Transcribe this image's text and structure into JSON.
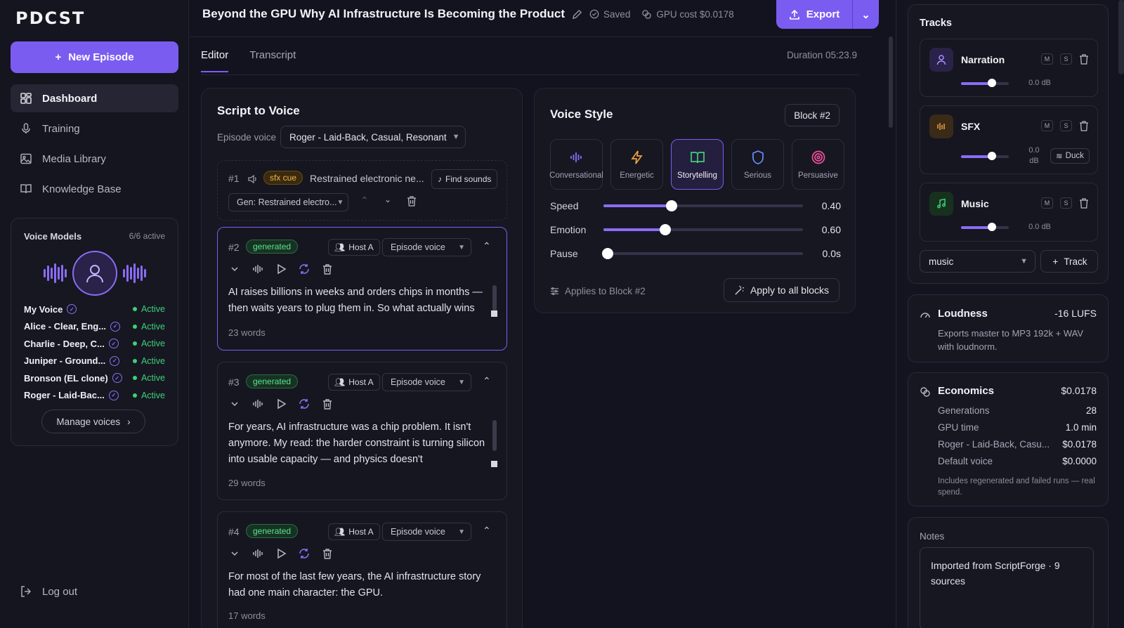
{
  "app": {
    "logo": "PDCST",
    "new_episode": "New Episode",
    "logout": "Log out"
  },
  "nav": [
    {
      "label": "Dashboard",
      "icon": "dashboard-icon",
      "active": true
    },
    {
      "label": "Training",
      "icon": "microphone-icon",
      "active": false
    },
    {
      "label": "Media Library",
      "icon": "image-icon",
      "active": false
    },
    {
      "label": "Knowledge Base",
      "icon": "book-icon",
      "active": false
    }
  ],
  "voice_models": {
    "title": "Voice Models",
    "count": "6/6 active",
    "items": [
      {
        "name": "My Voice",
        "status": "Active"
      },
      {
        "name": "Alice - Clear, Eng...",
        "status": "Active"
      },
      {
        "name": "Charlie - Deep, C...",
        "status": "Active"
      },
      {
        "name": "Juniper - Ground...",
        "status": "Active"
      },
      {
        "name": "Bronson (EL clone)",
        "status": "Active"
      },
      {
        "name": "Roger - Laid-Bac...",
        "status": "Active"
      }
    ],
    "manage": "Manage voices"
  },
  "header": {
    "title": "Beyond the GPU Why AI Infrastructure Is Becoming the Product",
    "saved": "Saved",
    "gpu_cost": "GPU cost $0.0178",
    "export": "Export"
  },
  "tabs": [
    {
      "label": "Editor",
      "active": true
    },
    {
      "label": "Transcript",
      "active": false
    }
  ],
  "duration": "Duration 05:23.9",
  "script": {
    "title": "Script to Voice",
    "episode_voice_label": "Episode voice",
    "episode_voice": "Roger - Laid-Back, Casual, Resonant",
    "sfx_block": {
      "num": "#1",
      "badge": "sfx cue",
      "text": "Restrained electronic ne...",
      "find": "Find sounds",
      "gen_select": "Gen: Restrained electro..."
    },
    "blocks": [
      {
        "num": "#2",
        "badge": "generated",
        "host": "Host A",
        "voice": "Episode voice",
        "text": "AI raises billions in weeks and orders chips in months — then waits years to plug them in. So what actually wins",
        "words": "23 words"
      },
      {
        "num": "#3",
        "badge": "generated",
        "host": "Host A",
        "voice": "Episode voice",
        "text": "For years, AI infrastructure was a chip problem. It isn't anymore. My read: the harder constraint is turning silicon into usable capacity — and physics doesn't",
        "words": "29 words"
      },
      {
        "num": "#4",
        "badge": "generated",
        "host": "Host A",
        "voice": "Episode voice",
        "text": "For most of the last few years, the AI infrastructure story had one main character: the GPU.",
        "words": "17 words"
      }
    ]
  },
  "voice_style": {
    "title": "Voice Style",
    "block_tag": "Block #2",
    "styles": [
      {
        "label": "Conversational",
        "icon": "waveform-icon",
        "color": "#8b6cf6",
        "active": false
      },
      {
        "label": "Energetic",
        "icon": "lightning-icon",
        "color": "#f0a03c",
        "active": false
      },
      {
        "label": "Storytelling",
        "icon": "open-book-icon",
        "color": "#3fcf7a",
        "active": true
      },
      {
        "label": "Serious",
        "icon": "shield-icon",
        "color": "#6b8cff",
        "active": false
      },
      {
        "label": "Persuasive",
        "icon": "target-icon",
        "color": "#f0509a",
        "active": false
      }
    ],
    "sliders": [
      {
        "label": "Speed",
        "value": "0.40",
        "level": 0.34
      },
      {
        "label": "Emotion",
        "value": "0.60",
        "level": 0.31
      },
      {
        "label": "Pause",
        "value": "0.0s",
        "level": 0.02
      }
    ],
    "applies": "Applies to Block #2",
    "apply_all": "Apply to all blocks"
  },
  "tracks": {
    "title": "Tracks",
    "items": [
      {
        "name": "Narration",
        "icon": "person-icon",
        "db": "0.0 dB",
        "level": 0.65
      },
      {
        "name": "SFX",
        "icon": "sfx-wave-icon",
        "db": "0.0 dB",
        "level": 0.65,
        "duck": "Duck"
      },
      {
        "name": "Music",
        "icon": "music-note-icon",
        "db": "0.0 dB",
        "level": 0.65
      }
    ],
    "m": "M",
    "s": "S",
    "new_select": "music",
    "add_track": "Track"
  },
  "loudness": {
    "title": "Loudness",
    "value": "-16 LUFS",
    "note": "Exports master to MP3 192k + WAV with loudnorm."
  },
  "economics": {
    "title": "Economics",
    "total": "$0.0178",
    "rows": [
      {
        "label": "Generations",
        "value": "28"
      },
      {
        "label": "GPU time",
        "value": "1.0 min"
      },
      {
        "label": "Roger - Laid-Back, Casu...",
        "value": "$0.0178"
      },
      {
        "label": "Default voice",
        "value": "$0.0000"
      }
    ],
    "note": "Includes regenerated and failed runs — real spend."
  },
  "notes": {
    "label": "Notes",
    "text": "Imported from ScriptForge · 9 sources"
  },
  "colors": {
    "accent": "#7b5cf0",
    "active_green": "#3fcf7a",
    "sfx_orange": "#f0b545"
  }
}
